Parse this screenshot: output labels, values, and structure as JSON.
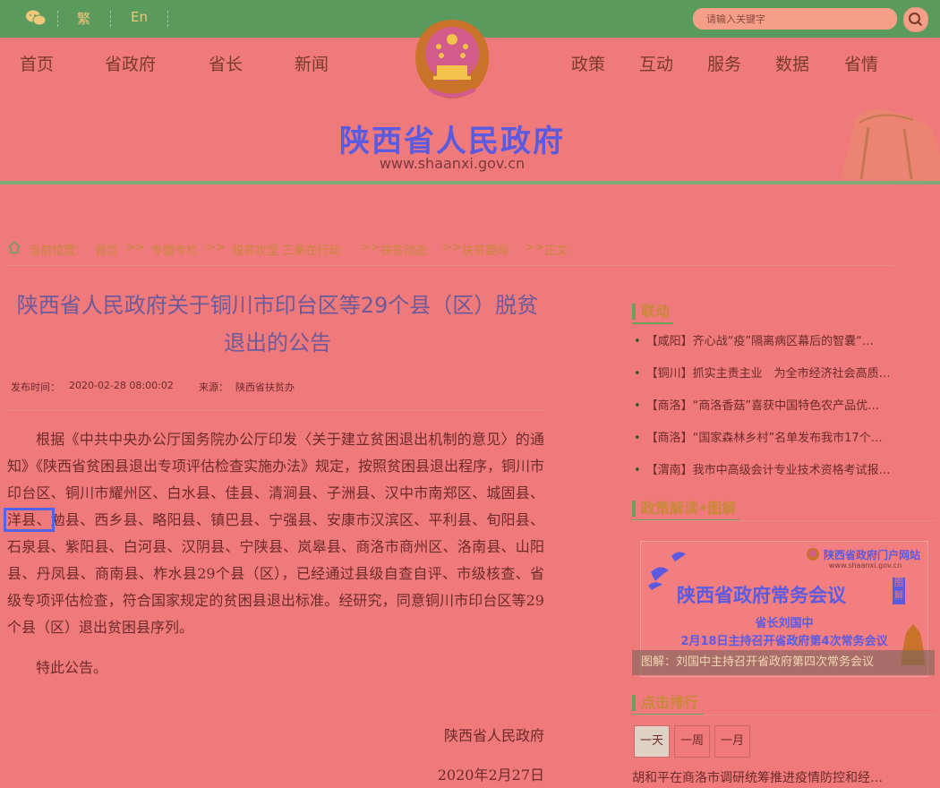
{
  "topbar": {
    "traditional_label": "繁",
    "english_label": "En",
    "search_placeholder": "请输入关键字"
  },
  "nav": {
    "left": [
      "首页",
      "省政府",
      "省长",
      "新闻"
    ],
    "right": [
      "政策",
      "互动",
      "服务",
      "数据",
      "省情"
    ]
  },
  "header": {
    "site_title": "陕西省人民政府",
    "site_url": "www.shaanxi.gov.cn"
  },
  "breadcrumb": {
    "prefix": "当前位置：",
    "items": [
      "首页",
      "专题专栏",
      "脱贫攻坚 三秦在行动",
      "扶贫动态",
      "扶贫要闻",
      "正文"
    ],
    "separator": ">>"
  },
  "article": {
    "title": "陕西省人民政府关于铜川市印台区等29个县（区）脱贫退出的公告",
    "publish_label": "发布时间：",
    "publish_time": "2020-02-28 08:00:02",
    "source_label": "来源：",
    "source": "陕西省扶贫办",
    "para1_before": "根据《中共中央办公厅国务院办公厅印发〈关于建立贫困退出机制的意见〉的通知》《陕西省贫困县退出专项评估检查实施办法》规定，按照贫困县退出程序，铜川市印台区、铜川市耀州区、白水县、佳县、清涧县、子洲县、汉中市南郑区、城固县、",
    "para1_highlight": "洋县、",
    "para1_after": "勉县、西乡县、略阳县、镇巴县、宁强县、安康市汉滨区、平利县、旬阳县、石泉县、紫阳县、白河县、汉阴县、宁陕县、岚皋县、商洛市商州区、洛南县、山阳县、丹凤县、商南县、柞水县29个县（区），已经通过县级自查自评、市级核查、省级专项评估检查，符合国家规定的贫困县退出标准。经研究，同意铜川市印台区等29个县（区）退出贫困县序列。",
    "para2": "特此公告。",
    "signature": "陕西省人民政府",
    "date": "2020年2月27日"
  },
  "sidebar": {
    "linkage_title": "联动",
    "linkage_items": [
      "【咸阳】齐心战“疫”隔离病区幕后的智囊“…",
      "【铜川】抓实主责主业　为全市经济社会高质…",
      "【商洛】“商洛香菇”喜获中国特色农产品优…",
      "【商洛】“国家森林乡村”名单发布我市17个…",
      "【渭南】我市中高级会计专业技术资格考试报…"
    ],
    "policy_title": "政策解读•图解",
    "promo": {
      "logo_text": "陕西省政府门户网站",
      "logo_sub": "www.shaanxi.gov.cn",
      "main": "陕西省政府常务会议",
      "tag": "图解",
      "line1": "省长刘国中",
      "line2": "2月18日主持召开省政府第4次常务会议",
      "caption": "图解：刘国中主持召开省政府第四次常务会议"
    },
    "rank_title": "点击排行",
    "rank_tabs": [
      "一天",
      "一周",
      "一月"
    ],
    "rank_first": "胡和平在商洛市调研统筹推进疫情防控和经…"
  }
}
